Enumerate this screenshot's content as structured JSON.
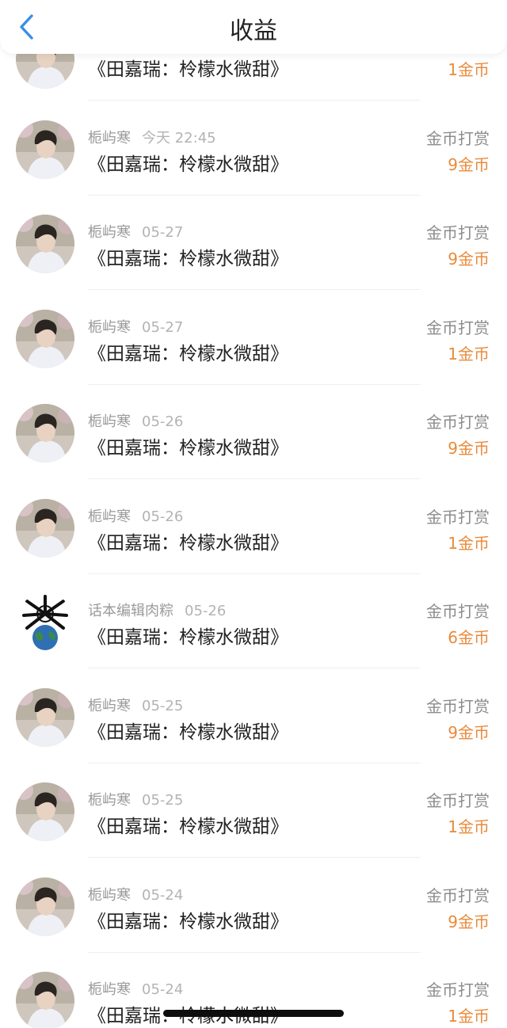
{
  "header": {
    "title": "收益",
    "back_icon": "chevron-left-icon",
    "back_color": "#3a8ee6"
  },
  "amount_color": "#e98a3a",
  "rows": [
    {
      "user": "",
      "date": "",
      "work": "《田嘉瑞：柃檬水微甜》",
      "kind": "",
      "amount": "1金币",
      "avatar": "photo"
    },
    {
      "user": "栀屿寒",
      "date": "今天 22:45",
      "work": "《田嘉瑞：柃檬水微甜》",
      "kind": "金币打赏",
      "amount": "9金币",
      "avatar": "photo"
    },
    {
      "user": "栀屿寒",
      "date": "05-27",
      "work": "《田嘉瑞：柃檬水微甜》",
      "kind": "金币打赏",
      "amount": "9金币",
      "avatar": "photo"
    },
    {
      "user": "栀屿寒",
      "date": "05-27",
      "work": "《田嘉瑞：柃檬水微甜》",
      "kind": "金币打赏",
      "amount": "1金币",
      "avatar": "photo"
    },
    {
      "user": "栀屿寒",
      "date": "05-26",
      "work": "《田嘉瑞：柃檬水微甜》",
      "kind": "金币打赏",
      "amount": "9金币",
      "avatar": "photo"
    },
    {
      "user": "栀屿寒",
      "date": "05-26",
      "work": "《田嘉瑞：柃檬水微甜》",
      "kind": "金币打赏",
      "amount": "1金币",
      "avatar": "photo"
    },
    {
      "user": "话本编辑肉粽",
      "date": "05-26",
      "work": "《田嘉瑞：柃檬水微甜》",
      "kind": "金币打赏",
      "amount": "6金币",
      "avatar": "earth"
    },
    {
      "user": "栀屿寒",
      "date": "05-25",
      "work": "《田嘉瑞：柃檬水微甜》",
      "kind": "金币打赏",
      "amount": "9金币",
      "avatar": "photo"
    },
    {
      "user": "栀屿寒",
      "date": "05-25",
      "work": "《田嘉瑞：柃檬水微甜》",
      "kind": "金币打赏",
      "amount": "1金币",
      "avatar": "photo"
    },
    {
      "user": "栀屿寒",
      "date": "05-24",
      "work": "《田嘉瑞：柃檬水微甜》",
      "kind": "金币打赏",
      "amount": "9金币",
      "avatar": "photo"
    },
    {
      "user": "栀屿寒",
      "date": "05-24",
      "work": "《田嘉瑞：柃檬水微甜》",
      "kind": "金币打赏",
      "amount": "1金币",
      "avatar": "photo"
    }
  ]
}
